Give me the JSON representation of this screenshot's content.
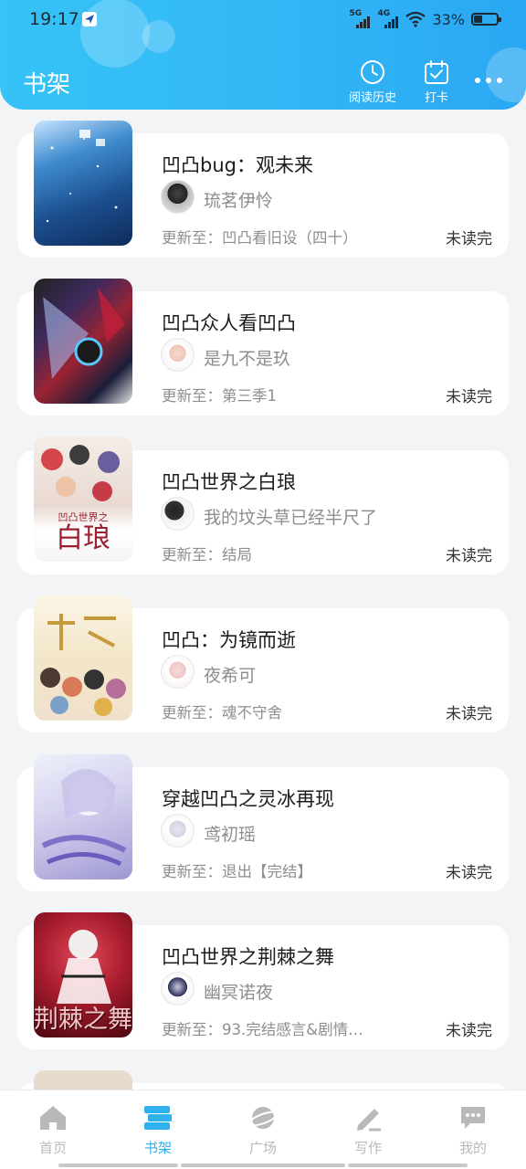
{
  "status_bar": {
    "time": "19:17",
    "net1": "5G",
    "net2": "4G",
    "battery": "33%",
    "battery_level": 0.33
  },
  "header": {
    "title": "书架",
    "history_label": "阅读历史",
    "checkin_label": "打卡"
  },
  "colors": {
    "accent": "#2fb1ee",
    "header_start": "#36c3f7",
    "header_end": "#2aa7f3"
  },
  "books": [
    {
      "title": "凹凸bug：观未来",
      "author": "琉茗伊怜",
      "update": "更新至：凹凸看旧设（四十）",
      "status": "未读完"
    },
    {
      "title": "凹凸众人看凹凸",
      "author": "是九不是玖",
      "update": "更新至：第三季1",
      "status": "未读完"
    },
    {
      "title": "凹凸世界之白琅",
      "author": "我的坟头草已经半尺了",
      "update": "更新至：结局",
      "status": "未读完",
      "cover_text": [
        "凹凸世界之",
        "白琅"
      ]
    },
    {
      "title": "凹凸：为镜而逝",
      "author": "夜希可",
      "update": "更新至：魂不守舍",
      "status": "未读完"
    },
    {
      "title": "穿越凹凸之灵冰再现",
      "author": "鸢初瑶",
      "update": "更新至：退出【完结】",
      "status": "未读完"
    },
    {
      "title": "凹凸世界之荆棘之舞",
      "author": "幽冥诺夜",
      "update": "更新至：93.完结感言&剧情…",
      "status": "未读完",
      "cover_text": [
        "荆棘之舞"
      ]
    }
  ],
  "nav": [
    {
      "label": "首页",
      "icon": "home-icon"
    },
    {
      "label": "书架",
      "icon": "bookshelf-icon",
      "active": true
    },
    {
      "label": "广场",
      "icon": "planet-icon"
    },
    {
      "label": "写作",
      "icon": "pen-icon"
    },
    {
      "label": "我的",
      "icon": "chat-bubble-icon"
    }
  ]
}
